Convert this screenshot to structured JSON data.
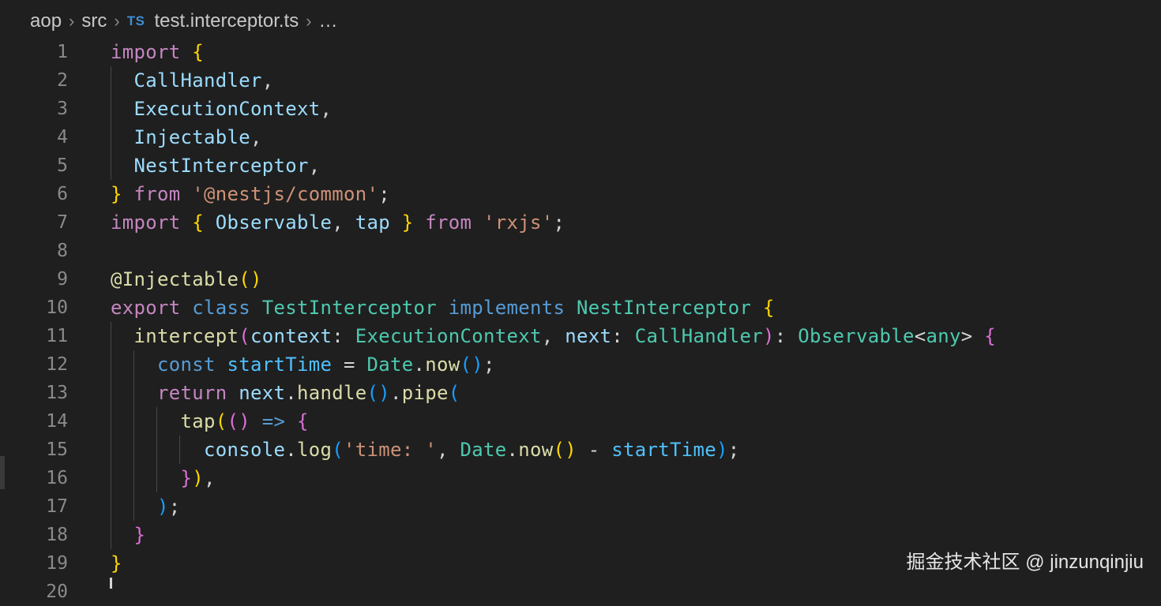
{
  "breadcrumb": {
    "items": [
      "aop",
      "src",
      "test.interceptor.ts",
      "…"
    ],
    "file_badge": "TS"
  },
  "colors": {
    "keyword": "#c586c0",
    "storage": "#569cd6",
    "type": "#4ec9b0",
    "variable": "#9cdcfe",
    "function": "#dcdcaa",
    "string": "#ce9178",
    "plain": "#d4d4d4",
    "bracket1": "#ffd700",
    "bracket2": "#da70d6",
    "bracket3": "#179fff"
  },
  "code_lines": [
    {
      "n": "1",
      "tokens": [
        [
          "import",
          "#c586c0"
        ],
        [
          " ",
          "#d4d4d4"
        ],
        [
          "{",
          "#ffd700"
        ]
      ]
    },
    {
      "n": "2",
      "tokens": [
        [
          "  CallHandler",
          "#9cdcfe"
        ],
        [
          ",",
          "#d4d4d4"
        ]
      ]
    },
    {
      "n": "3",
      "tokens": [
        [
          "  ExecutionContext",
          "#9cdcfe"
        ],
        [
          ",",
          "#d4d4d4"
        ]
      ]
    },
    {
      "n": "4",
      "tokens": [
        [
          "  Injectable",
          "#9cdcfe"
        ],
        [
          ",",
          "#d4d4d4"
        ]
      ]
    },
    {
      "n": "5",
      "tokens": [
        [
          "  NestInterceptor",
          "#9cdcfe"
        ],
        [
          ",",
          "#d4d4d4"
        ]
      ]
    },
    {
      "n": "6",
      "tokens": [
        [
          "}",
          "#ffd700"
        ],
        [
          " ",
          "#d4d4d4"
        ],
        [
          "from",
          "#c586c0"
        ],
        [
          " ",
          "#d4d4d4"
        ],
        [
          "'@nestjs/common'",
          "#ce9178"
        ],
        [
          ";",
          "#d4d4d4"
        ]
      ]
    },
    {
      "n": "7",
      "tokens": [
        [
          "import",
          "#c586c0"
        ],
        [
          " ",
          "#d4d4d4"
        ],
        [
          "{",
          "#ffd700"
        ],
        [
          " Observable",
          "#9cdcfe"
        ],
        [
          ", ",
          "#d4d4d4"
        ],
        [
          "tap",
          "#9cdcfe"
        ],
        [
          " ",
          "#d4d4d4"
        ],
        [
          "}",
          "#ffd700"
        ],
        [
          " ",
          "#d4d4d4"
        ],
        [
          "from",
          "#c586c0"
        ],
        [
          " ",
          "#d4d4d4"
        ],
        [
          "'rxjs'",
          "#ce9178"
        ],
        [
          ";",
          "#d4d4d4"
        ]
      ]
    },
    {
      "n": "8",
      "tokens": []
    },
    {
      "n": "9",
      "tokens": [
        [
          "@Injectable",
          "#dcdcaa"
        ],
        [
          "()",
          "#ffd700"
        ]
      ]
    },
    {
      "n": "10",
      "tokens": [
        [
          "export",
          "#c586c0"
        ],
        [
          " ",
          "#d4d4d4"
        ],
        [
          "class",
          "#569cd6"
        ],
        [
          " ",
          "#d4d4d4"
        ],
        [
          "TestInterceptor",
          "#4ec9b0"
        ],
        [
          " ",
          "#d4d4d4"
        ],
        [
          "implements",
          "#569cd6"
        ],
        [
          " ",
          "#d4d4d4"
        ],
        [
          "NestInterceptor",
          "#4ec9b0"
        ],
        [
          " ",
          "#d4d4d4"
        ],
        [
          "{",
          "#ffd700"
        ]
      ]
    },
    {
      "n": "11",
      "tokens": [
        [
          "  intercept",
          "#dcdcaa"
        ],
        [
          "(",
          "#da70d6"
        ],
        [
          "context",
          "#9cdcfe"
        ],
        [
          ": ",
          "#d4d4d4"
        ],
        [
          "ExecutionContext",
          "#4ec9b0"
        ],
        [
          ", ",
          "#d4d4d4"
        ],
        [
          "next",
          "#9cdcfe"
        ],
        [
          ": ",
          "#d4d4d4"
        ],
        [
          "CallHandler",
          "#4ec9b0"
        ],
        [
          ")",
          "#da70d6"
        ],
        [
          ": ",
          "#d4d4d4"
        ],
        [
          "Observable",
          "#4ec9b0"
        ],
        [
          "<",
          "#d4d4d4"
        ],
        [
          "any",
          "#4ec9b0"
        ],
        [
          "> ",
          "#d4d4d4"
        ],
        [
          "{",
          "#da70d6"
        ]
      ]
    },
    {
      "n": "12",
      "tokens": [
        [
          "    const",
          "#569cd6"
        ],
        [
          " ",
          "#d4d4d4"
        ],
        [
          "startTime",
          "#4fc1ff"
        ],
        [
          " = ",
          "#d4d4d4"
        ],
        [
          "Date",
          "#4ec9b0"
        ],
        [
          ".",
          "#d4d4d4"
        ],
        [
          "now",
          "#dcdcaa"
        ],
        [
          "()",
          "#179fff"
        ],
        [
          ";",
          "#d4d4d4"
        ]
      ]
    },
    {
      "n": "13",
      "tokens": [
        [
          "    return",
          "#c586c0"
        ],
        [
          " ",
          "#d4d4d4"
        ],
        [
          "next",
          "#9cdcfe"
        ],
        [
          ".",
          "#d4d4d4"
        ],
        [
          "handle",
          "#dcdcaa"
        ],
        [
          "()",
          "#179fff"
        ],
        [
          ".",
          "#d4d4d4"
        ],
        [
          "pipe",
          "#dcdcaa"
        ],
        [
          "(",
          "#179fff"
        ]
      ]
    },
    {
      "n": "14",
      "tokens": [
        [
          "      tap",
          "#dcdcaa"
        ],
        [
          "(",
          "#ffd700"
        ],
        [
          "()",
          "#da70d6"
        ],
        [
          " ",
          "#d4d4d4"
        ],
        [
          "=>",
          "#569cd6"
        ],
        [
          " ",
          "#d4d4d4"
        ],
        [
          "{",
          "#da70d6"
        ]
      ]
    },
    {
      "n": "15",
      "tokens": [
        [
          "        console",
          "#9cdcfe"
        ],
        [
          ".",
          "#d4d4d4"
        ],
        [
          "log",
          "#dcdcaa"
        ],
        [
          "(",
          "#179fff"
        ],
        [
          "'time: '",
          "#ce9178"
        ],
        [
          ", ",
          "#d4d4d4"
        ],
        [
          "Date",
          "#4ec9b0"
        ],
        [
          ".",
          "#d4d4d4"
        ],
        [
          "now",
          "#dcdcaa"
        ],
        [
          "()",
          "#ffd700"
        ],
        [
          " - ",
          "#d4d4d4"
        ],
        [
          "startTime",
          "#4fc1ff"
        ],
        [
          ")",
          "#179fff"
        ],
        [
          ";",
          "#d4d4d4"
        ]
      ]
    },
    {
      "n": "16",
      "tokens": [
        [
          "      }",
          "#da70d6"
        ],
        [
          ")",
          "#ffd700"
        ],
        [
          ",",
          "#d4d4d4"
        ]
      ]
    },
    {
      "n": "17",
      "tokens": [
        [
          "    )",
          "#179fff"
        ],
        [
          ";",
          "#d4d4d4"
        ]
      ]
    },
    {
      "n": "18",
      "tokens": [
        [
          "  }",
          "#da70d6"
        ]
      ]
    },
    {
      "n": "19",
      "tokens": [
        [
          "}",
          "#ffd700"
        ]
      ]
    },
    {
      "n": "20",
      "tokens": []
    }
  ],
  "watermark": "掘金技术社区 @ jinzunqinjiu"
}
